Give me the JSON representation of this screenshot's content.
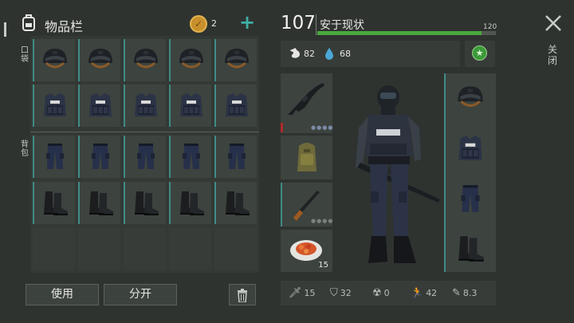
{
  "inventory": {
    "title": "物品栏",
    "coin_count": "2",
    "plus": "+",
    "section_pockets": "口袋",
    "section_backpack": "背包",
    "use_label": "使用",
    "split_label": "分开"
  },
  "character": {
    "level": "107",
    "status": "安于现状",
    "xp_max": "120",
    "xp_fraction": 0.92,
    "food": "82",
    "water": "68"
  },
  "close_label": "关闭",
  "equipment": {
    "food_count": "15"
  },
  "stats": {
    "attack": "15",
    "armor": "32",
    "radiation": "0",
    "speed": "42",
    "stealth": "8.3"
  }
}
